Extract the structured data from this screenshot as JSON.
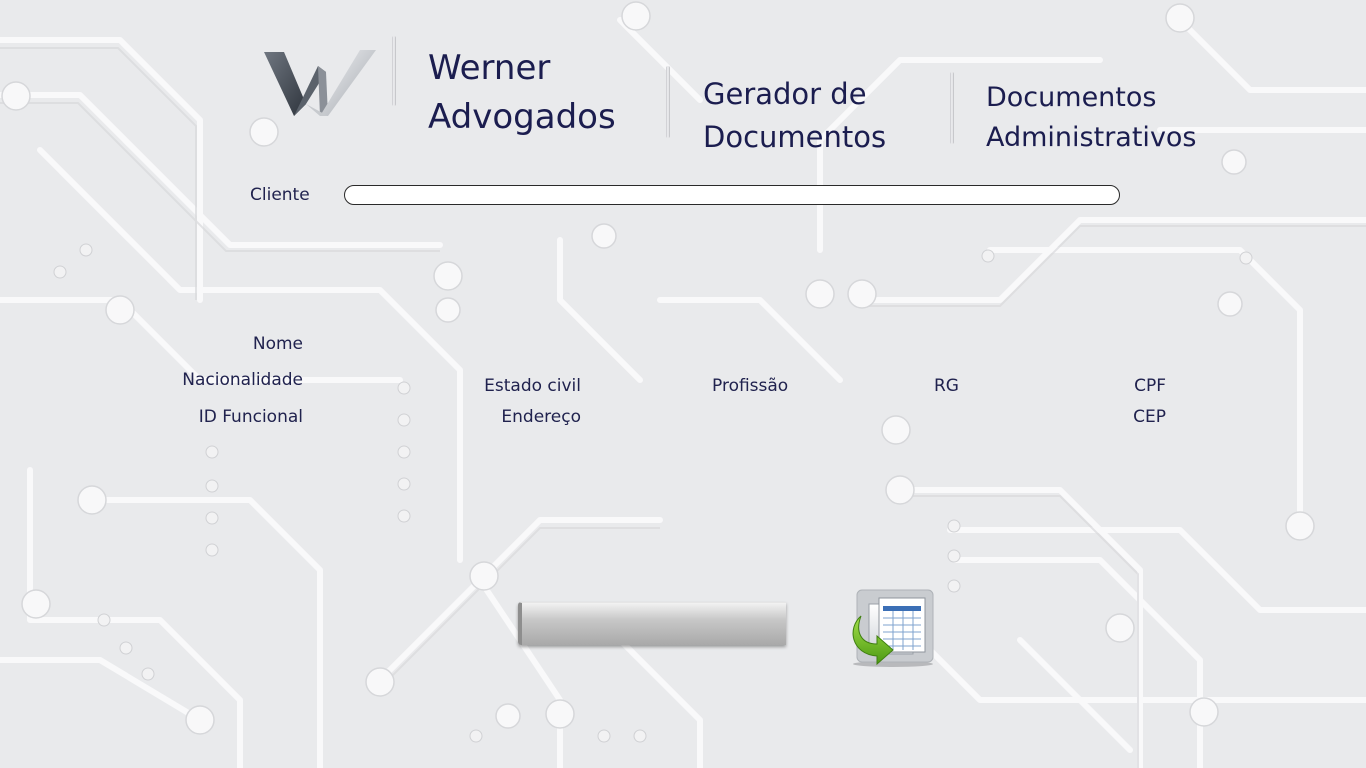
{
  "header": {
    "brand_line1": "Werner",
    "brand_line2": "Advogados",
    "module_line1": "Gerador de",
    "module_line2": "Documentos",
    "section_line1": "Documentos",
    "section_line2": "Administrativos"
  },
  "form": {
    "client_label": "Cliente",
    "client_value": "",
    "nome_label": "Nome",
    "nacionalidade_label": "Nacionalidade",
    "estado_civil_label": "Estado civil",
    "profissao_label": "Profissão",
    "rg_label": "RG",
    "cpf_label": "CPF",
    "id_funcional_label": "ID Funcional",
    "endereco_label": "Endereço",
    "cep_label": "CEP"
  },
  "icons": {
    "logo": "werner-logo",
    "export": "export-spreadsheet-icon"
  },
  "colors": {
    "text": "#1b1d4f",
    "background": "#e9eaec",
    "export_arrow": "#7fcf27"
  }
}
